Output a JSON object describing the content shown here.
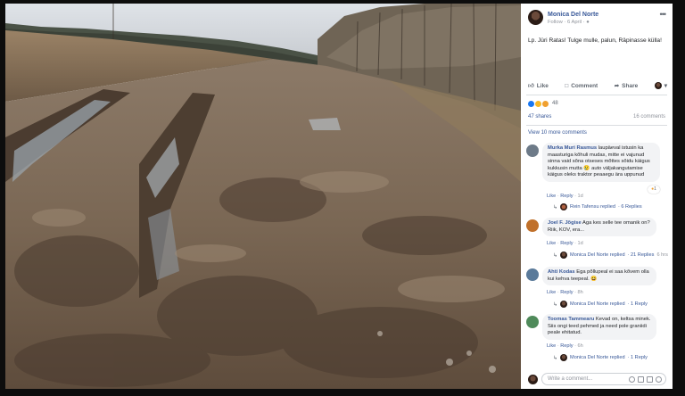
{
  "post": {
    "author": "Monica Del Norte",
    "follow": "Follow",
    "date": "6 April",
    "privacy_icon": "globe-icon",
    "text": "Lp. Jüri Ratas! Tulge mulle, palun, Räpinasse külla!",
    "more_icon": "ellipsis-icon"
  },
  "actions": {
    "like": "Like",
    "comment": "Comment",
    "share": "Share"
  },
  "reactions": {
    "count": "48",
    "icons": [
      "like-icon",
      "wow-icon",
      "haha-icon"
    ]
  },
  "stats": {
    "shares": "47 shares",
    "comments": "16 comments"
  },
  "view_more": "View 10 more comments",
  "comments": [
    {
      "name": "Murka Muri Rasmus",
      "text": "laupäeval istusin ka maasturiga kõhuli mudas, mitte ei vajunud sinna vaid sõna otseses mõttes sõidu käigus kukkusin mutta 😢 auto väljakangutamise käigus oleks traktor peaaegu ära uppunud",
      "like": "Like",
      "reply": "Reply",
      "age": "1d",
      "reaction_count": "1",
      "reply_by": "Rein Tafensu replied",
      "reply_count": "· 6 Replies"
    },
    {
      "name": "Joel F. Jõgise",
      "text": "Aga kes selle tee omanik on? Riik, KOV, era...",
      "like": "Like",
      "reply": "Reply",
      "age": "1d",
      "reply_by": "Monica Del Norte replied",
      "reply_count": "· 21 Replies",
      "reply_age": "6 hrs"
    },
    {
      "name": "Ahti Kodas",
      "text": "Ega põllupeal ei saa kõvem olla kui kehva teepeal. 😆",
      "like": "Like",
      "reply": "Reply",
      "age": "8h",
      "reply_by": "Monica Del Norte replied",
      "reply_count": "· 1 Reply"
    },
    {
      "name": "Toomas Tammearu",
      "text": "Kevad on, keltsa minek. Siis ongi teed pehmed ja need pole graniidi peale ehitatud.",
      "like": "Like",
      "reply": "Reply",
      "age": "6h",
      "reply_by": "Monica Del Norte replied",
      "reply_count": "· 1 Reply"
    }
  ],
  "write_comment": {
    "placeholder": "Write a comment...",
    "icons": [
      "emoji-icon",
      "camera-icon",
      "gif-icon",
      "sticker-icon"
    ]
  },
  "colors": {
    "link": "#385898",
    "meta": "#90949c",
    "bubble": "#f2f3f5"
  }
}
